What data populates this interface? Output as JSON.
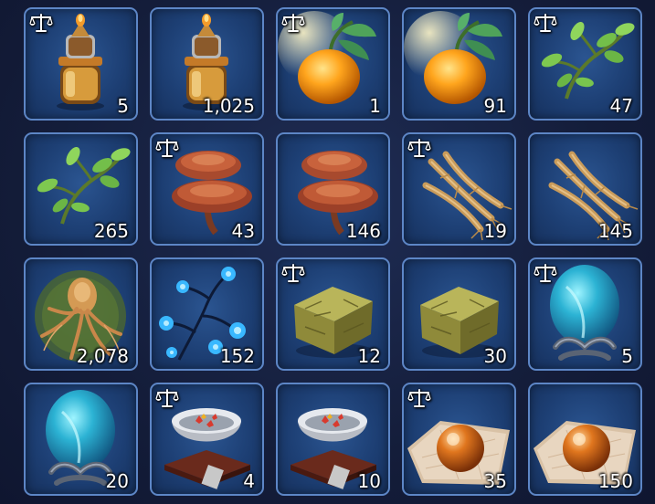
{
  "inventory": {
    "slots": [
      {
        "item": "lantern-elixir-bottle",
        "count": "5",
        "tradable": true
      },
      {
        "item": "lantern-elixir-bottle",
        "count": "1,025",
        "tradable": false
      },
      {
        "item": "glowing-orange-fruit",
        "count": "1",
        "tradable": true
      },
      {
        "item": "glowing-orange-fruit",
        "count": "91",
        "tradable": false
      },
      {
        "item": "green-herb-sprig",
        "count": "47",
        "tradable": true
      },
      {
        "item": "green-herb-sprig",
        "count": "265",
        "tradable": false
      },
      {
        "item": "lingzhi-mushroom",
        "count": "43",
        "tradable": true
      },
      {
        "item": "lingzhi-mushroom",
        "count": "146",
        "tradable": false
      },
      {
        "item": "ginseng-roots",
        "count": "19",
        "tradable": true
      },
      {
        "item": "ginseng-roots",
        "count": "145",
        "tradable": false
      },
      {
        "item": "ancient-mandrake-root",
        "count": "2,078",
        "tradable": false
      },
      {
        "item": "blue-glowing-flower",
        "count": "152",
        "tradable": false
      },
      {
        "item": "mossy-stone-block",
        "count": "12",
        "tradable": true
      },
      {
        "item": "mossy-stone-block",
        "count": "30",
        "tradable": false
      },
      {
        "item": "cyan-spirit-egg",
        "count": "5",
        "tradable": true
      },
      {
        "item": "cyan-spirit-egg",
        "count": "20",
        "tradable": false
      },
      {
        "item": "silver-bowl-of-flowers",
        "count": "4",
        "tradable": true
      },
      {
        "item": "silver-bowl-of-flowers",
        "count": "10",
        "tradable": false
      },
      {
        "item": "amber-orb-on-cloth",
        "count": "35",
        "tradable": true
      },
      {
        "item": "amber-orb-on-cloth",
        "count": "150",
        "tradable": false
      }
    ],
    "icons": {
      "tradable": "balance-scale-icon"
    },
    "colors": {
      "slot_border": "#5d86c6",
      "slot_fill": "#1d3f74",
      "background": "#141d3a"
    }
  }
}
